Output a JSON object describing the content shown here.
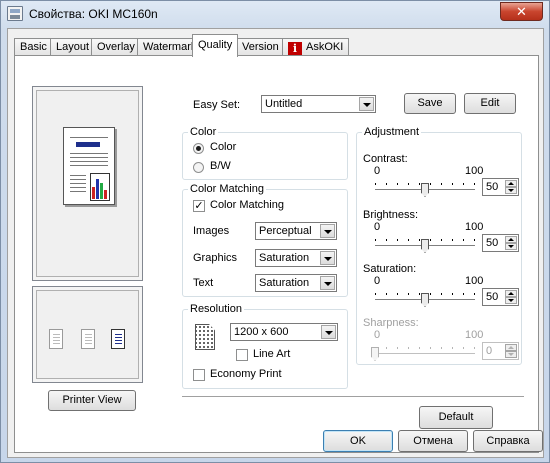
{
  "window": {
    "title": "Свойства: OKI MC160n",
    "close_symbol": "✕"
  },
  "tabs": [
    {
      "label": "Basic"
    },
    {
      "label": "Layout"
    },
    {
      "label": "Overlay"
    },
    {
      "label": "Watermark"
    },
    {
      "label": "Quality",
      "active": true
    },
    {
      "label": "Version"
    },
    {
      "label": "AskOKI",
      "icon": "info-icon"
    }
  ],
  "info_icon_glyph": "i",
  "easy_set": {
    "label": "Easy Set:",
    "value": "Untitled",
    "save_label": "Save",
    "edit_label": "Edit"
  },
  "color_group": {
    "title": "Color",
    "options": [
      "Color",
      "B/W"
    ],
    "selected": "Color"
  },
  "color_matching": {
    "title": "Color Matching",
    "checkbox_label": "Color Matching",
    "checked": true,
    "rows": [
      {
        "label": "Images",
        "value": "Perceptual"
      },
      {
        "label": "Graphics",
        "value": "Saturation"
      },
      {
        "label": "Text",
        "value": "Saturation"
      }
    ]
  },
  "resolution": {
    "title": "Resolution",
    "value": "1200 x 600",
    "line_art_label": "Line Art",
    "line_art_checked": false,
    "economy_label": "Economy Print",
    "economy_checked": false
  },
  "adjustment": {
    "title": "Adjustment",
    "sliders": [
      {
        "label": "Contrast:",
        "min_label": "0",
        "max_label": "100",
        "value": "50",
        "level": 0.5,
        "enabled": true
      },
      {
        "label": "Brightness:",
        "min_label": "0",
        "max_label": "100",
        "value": "50",
        "level": 0.5,
        "enabled": true
      },
      {
        "label": "Saturation:",
        "min_label": "0",
        "max_label": "100",
        "value": "50",
        "level": 0.5,
        "enabled": true
      },
      {
        "label": "Sharpness:",
        "min_label": "0",
        "max_label": "100",
        "value": "0",
        "level": 0,
        "enabled": false
      }
    ]
  },
  "printer_view_label": "Printer View",
  "default_label": "Default",
  "footer": {
    "ok": "OK",
    "cancel": "Отмена",
    "help": "Справка"
  },
  "preview_bar_colors": [
    "#cc2222",
    "#2233aa",
    "#22aa44",
    "#cc2222",
    "#2233aa"
  ]
}
